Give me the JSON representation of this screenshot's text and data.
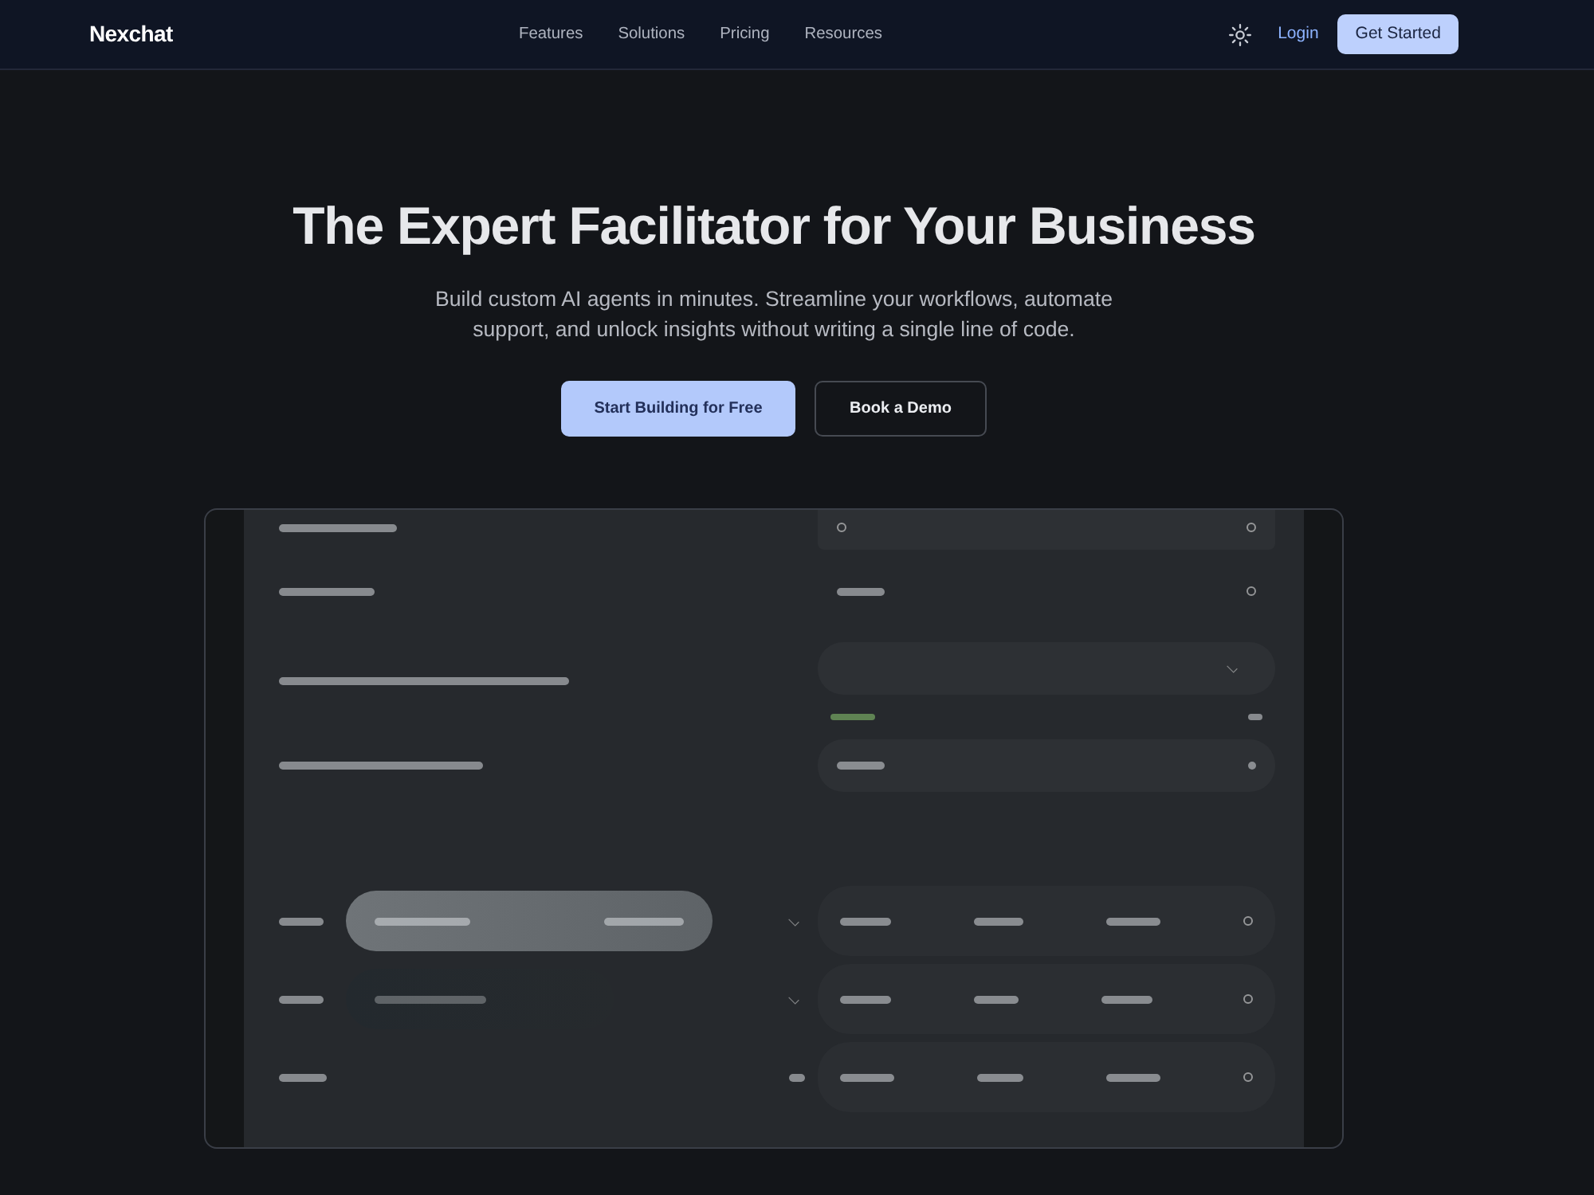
{
  "navbar": {
    "brand": "Nexchat",
    "links": [
      "Features",
      "Solutions",
      "Pricing",
      "Resources"
    ],
    "login": "Login",
    "cta": "Get Started"
  },
  "hero": {
    "title": "The Expert Facilitator for Your Business",
    "subtitle": "Build custom AI agents in minutes. Streamline your workflows, automate support, and unlock insights without writing a single line of code.",
    "buttons": [
      {
        "label": "Start Building for Free",
        "kind": "primary"
      },
      {
        "label": "Book a Demo",
        "kind": "outline"
      }
    ]
  }
}
